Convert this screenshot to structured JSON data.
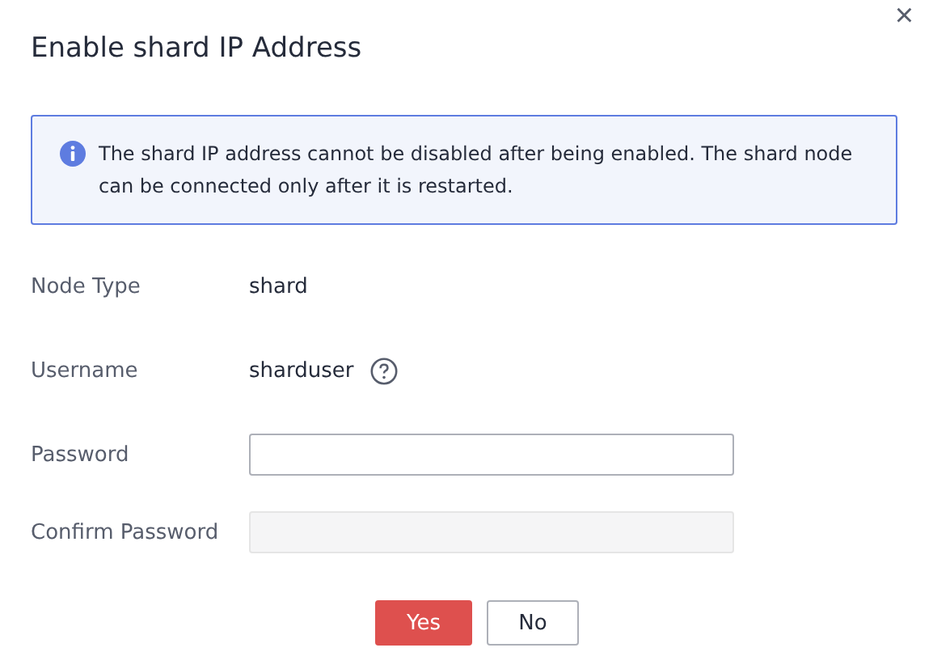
{
  "dialog": {
    "title": "Enable shard IP Address",
    "close": "×"
  },
  "notice": {
    "text": "The shard IP address cannot be disabled after being enabled. The shard node can be connected only after it is restarted."
  },
  "fields": [
    {
      "label": "Node Type",
      "kind": "text",
      "value": "shard"
    },
    {
      "label": "Username",
      "kind": "text_help",
      "value": "sharduser"
    },
    {
      "label": "Password",
      "kind": "input",
      "disabled": false
    },
    {
      "label": "Confirm Password",
      "kind": "input",
      "disabled": true
    }
  ],
  "buttons": [
    {
      "label": "Yes",
      "kind": "primary"
    },
    {
      "label": "No",
      "kind": "secondary"
    }
  ]
}
